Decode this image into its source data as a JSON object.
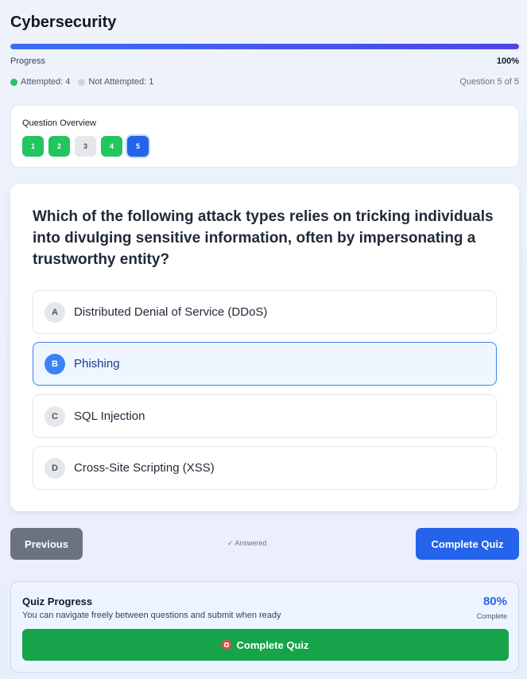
{
  "header": {
    "title": "Cybersecurity",
    "progress_label": "Progress",
    "progress_percent_text": "100%",
    "progress_fraction": 1.0,
    "attempted_label": "Attempted: 4",
    "not_attempted_label": "Not Attempted: 1",
    "question_counter": "Question 5 of 5"
  },
  "overview": {
    "title": "Question Overview",
    "buttons": [
      {
        "label": "1",
        "status": "attempted"
      },
      {
        "label": "2",
        "status": "attempted"
      },
      {
        "label": "3",
        "status": "not-attempted"
      },
      {
        "label": "4",
        "status": "attempted"
      },
      {
        "label": "5",
        "status": "current"
      }
    ]
  },
  "question": {
    "text": "Which of the following attack types relies on tricking individuals into divulging sensitive information, often by impersonating a trustworthy entity?",
    "options": [
      {
        "letter": "A",
        "text": "Distributed Denial of Service (DDoS)",
        "selected": false
      },
      {
        "letter": "B",
        "text": "Phishing",
        "selected": true
      },
      {
        "letter": "C",
        "text": "SQL Injection",
        "selected": false
      },
      {
        "letter": "D",
        "text": "Cross-Site Scripting (XSS)",
        "selected": false
      }
    ]
  },
  "nav": {
    "previous_label": "Previous",
    "answered_label": "✓ Answered",
    "complete_label": "Complete Quiz"
  },
  "summary": {
    "title": "Quiz Progress",
    "subtitle": "You can navigate freely between questions and submit when ready",
    "percent": "80%",
    "percent_caption": "Complete",
    "button_label": "Complete Quiz",
    "button_icon": "target-icon"
  },
  "colors": {
    "accent": "#2563eb",
    "success": "#22c55e",
    "muted": "#6b7280"
  }
}
